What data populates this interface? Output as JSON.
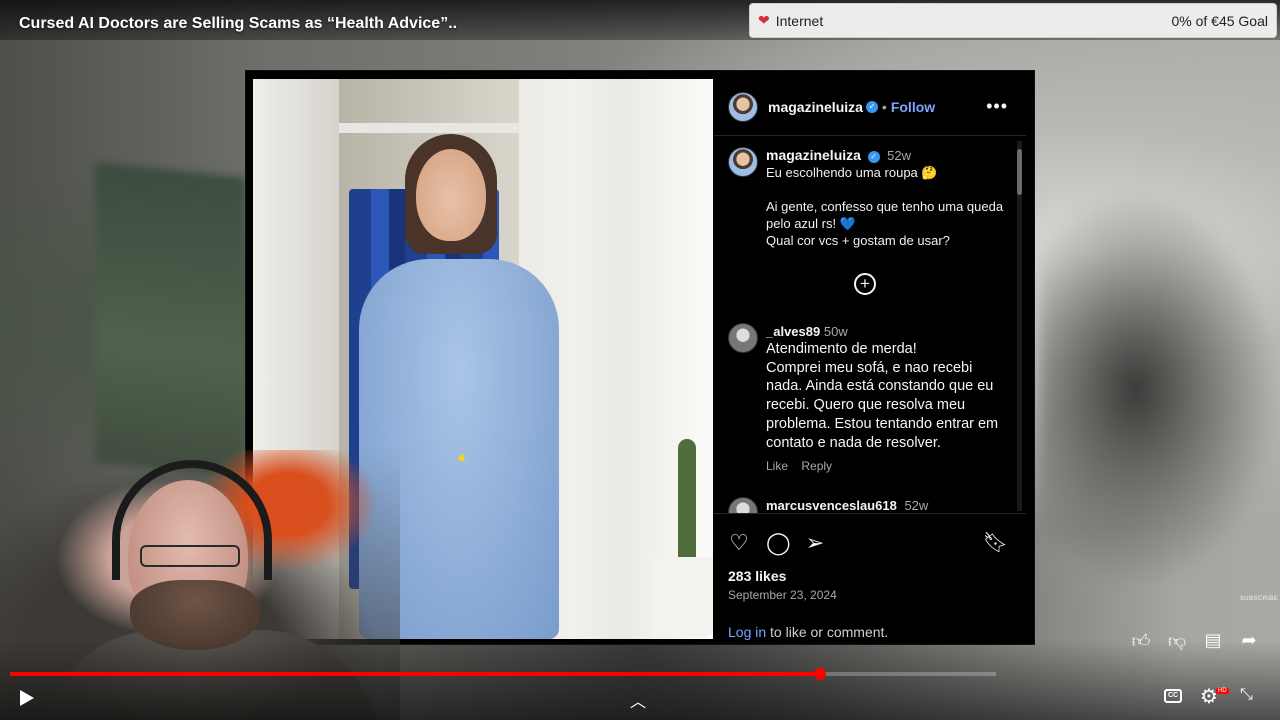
{
  "video": {
    "title": "Cursed AI Doctors are Selling Scams as “Health Advice”.."
  },
  "goal_widget": {
    "icon": "heart-icon",
    "label": "Internet",
    "amount": "0% of €45 Goal",
    "color": "#d62c3a"
  },
  "post": {
    "header": {
      "username": "magazineluiza",
      "separator": "•",
      "follow_label": "Follow",
      "more_icon": "more-horizontal-icon"
    },
    "caption": {
      "username": "magazineluiza",
      "time": "52w",
      "line1": "Eu escolhendo uma roupa 🤔",
      "line2": "Ai gente, confesso que tenho uma queda pelo azul rs! 💙",
      "line3": "Qual cor vcs + gostam de usar?"
    },
    "comments": [
      {
        "username": "_alves89",
        "time": "50w",
        "text_l1": "Atendimento de merda!",
        "text_l2": "Comprei meu sofá, e nao recebi nada. Ainda está constando que eu recebi. Quero que resolva meu problema. Estou tentando entrar em contato e nada de resolver.",
        "like_label": "Like",
        "reply_label": "Reply"
      },
      {
        "username": "marcusvenceslau618",
        "time": "52w"
      }
    ],
    "likes": "283 likes",
    "date": "September 23, 2024",
    "login_link": "Log in",
    "login_suffix": " to like or comment.",
    "accent_color": "#7da6ff"
  },
  "player": {
    "progress_fraction": 0.822,
    "subscribe_mark": "SUBSCRIBE",
    "cc_label": "CC",
    "hd_label": "HD",
    "accent_color": "#ff0000"
  }
}
